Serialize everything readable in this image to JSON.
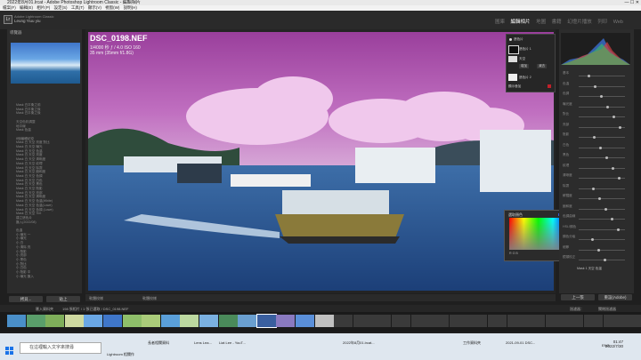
{
  "window": {
    "title": "2022年8月01.lrcat - Adobe Photoshop Lightroom Classic - 編輯相片",
    "controls": "—  ☐  ✕"
  },
  "menu": [
    "檔案(F)",
    "編輯(E)",
    "相片(P)",
    "設定(S)",
    "工具(T)",
    "顯示(V)",
    "視窗(W)",
    "說明(H)"
  ],
  "identity": {
    "line1": "Adobe Lightroom Classic",
    "line2": "Leung Yiuu yiu"
  },
  "modules": [
    "圖庫",
    "編輯相片",
    "地圖",
    "書籍",
    "幻燈片播放",
    "列印",
    "Web"
  ],
  "active_module": "編輯相片",
  "left_panel": {
    "navigator_title": "導覽器",
    "items": [
      "Mask 白平衡之前",
      "Mask 白平衡之後",
      "Mask 白平衡之後",
      "",
      "天空色彩調整",
      "地平線",
      "Mask 色溫",
      "",
      "8個編輯紀錄",
      "Mask 白 天空 亮度 對比",
      "Mask 白 天空 曝光",
      "Mask 白 天空 色溫",
      "Mask 白 天空 亮度",
      "Mask 白 天空 清晰度",
      "Mask 白 天空 紋理",
      "Mask 白 天空 除霧",
      "Mask 白 天空 飽和度",
      "Mask 白 天空 色調",
      "Mask 白 天空 白色",
      "Mask 白 天空 黑色",
      "Mask 白 天空 陰影",
      "Mask 白 天空 亮部",
      "Mask 白 天空 清晰度",
      "Mask 白 天空 色溫(White)",
      "Mask 白 天空 色溫(Lowe)",
      "Mask 白 天空 色調 (Lowe)",
      "Mask 白 天空 Tint",
      "建立遮色片",
      "匯入(2022/08)",
      "",
      "色溫",
      "小 曝光 一",
      "小 曝光",
      "小 白",
      "小 清除 亮",
      "小 陰影",
      "小 亮部",
      "小 黑色",
      "小 對比",
      "小 白色",
      "小 陰影 中",
      "小 曝光 匯入"
    ],
    "copy_btn": "拷貝...",
    "paste_btn": "貼上"
  },
  "photo": {
    "filename": "DSC_0198.NEF",
    "exif1": "1/4000 秒  ƒ / 4.0  ISO 160",
    "exif2": "35 mm (35mm f/1.8G)"
  },
  "mask_panel": {
    "title": "遮色片",
    "row1": "遮色片 1",
    "row2": "天空",
    "row3": "增加",
    "row4": "減去",
    "row5": "遮色片 2",
    "show_overlay": "顯示疊加"
  },
  "color_picker": {
    "title": "選取顏色",
    "value": "R G B"
  },
  "swatch_colors": [
    "#3b5bd0",
    "#6fa6e0",
    "#8f8f8f",
    "#b9a55e",
    "#d8d47b",
    "#c9c9c9"
  ],
  "right_panel": {
    "labels": [
      "基本",
      "色溫",
      "色調",
      "曝光度",
      "對比",
      "亮部",
      "陰影",
      "白色",
      "黑色",
      "紋理",
      "清晰度",
      "除霧",
      "鮮豔度",
      "飽和度",
      "色調曲線",
      "HSL/顏色",
      "顏色分級",
      "細節",
      "鏡頭校正"
    ],
    "preset": "Mask 1 天空 色溫",
    "prev_btn": "上一張",
    "reset_btn": "重設(Adobe)"
  },
  "toolbar": {
    "left": "軟體校樣",
    "right": "軟體校樣"
  },
  "filmstrip_header": {
    "source": "匯入資料夾",
    "count": "198 張相片 / 1 張已選取 / DSC_0198.NEF",
    "filter": "過濾器：",
    "filter_value": "關閉過濾器"
  },
  "taskbar": {
    "search": "在這裡輸入文字來搜尋",
    "apps": [
      "長者相關資料",
      "Lens Lea...",
      "Liat Lee - YouT...",
      "2022年8月01.lrcat...",
      "工作資料夾",
      "2021-09-01 DSC..."
    ],
    "lr_label": "Lightroom 相關作",
    "time": "01:47",
    "date": "2022/7/30",
    "lang": "ENG"
  }
}
